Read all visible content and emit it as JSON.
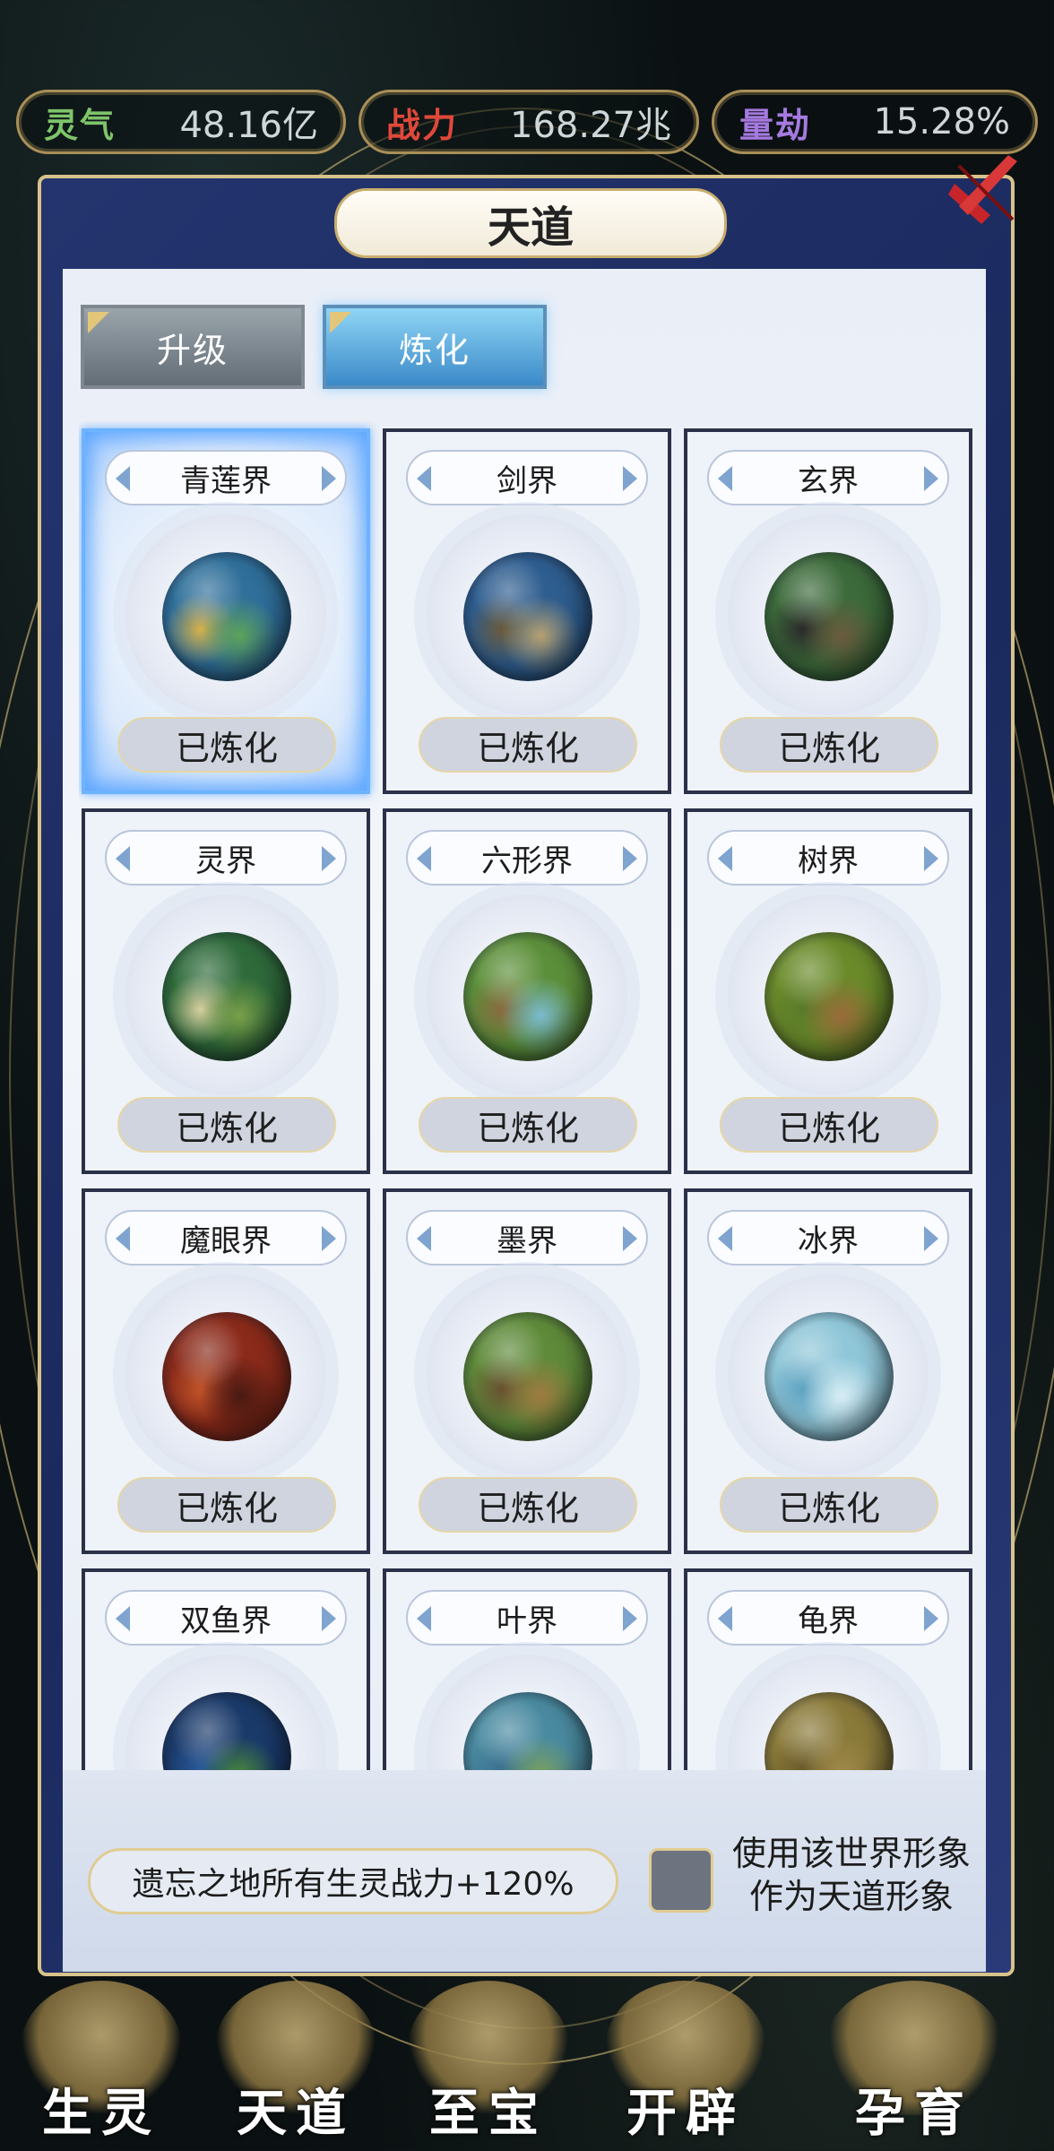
{
  "resources": [
    {
      "key": "灵气",
      "value": "48.16亿",
      "color": "#7ec46a"
    },
    {
      "key": "战力",
      "value": "168.27兆",
      "color": "#e0483a"
    },
    {
      "key": "量劫",
      "value": "15.28%",
      "color": "#a67ae0"
    }
  ],
  "panel": {
    "title": "天道"
  },
  "tabs": [
    {
      "label": "升级",
      "active": false
    },
    {
      "label": "炼化",
      "active": true
    }
  ],
  "worlds": [
    {
      "name": "青莲界",
      "status": "已炼化",
      "selected": true,
      "colors": [
        "#2f6f9a",
        "#5ea35a",
        "#d8b24a"
      ]
    },
    {
      "name": "剑界",
      "status": "已炼化",
      "selected": false,
      "colors": [
        "#2e5d8f",
        "#b7a170",
        "#6b5a3a"
      ]
    },
    {
      "name": "玄界",
      "status": "已炼化",
      "selected": false,
      "colors": [
        "#3c6a3a",
        "#6b5a3e",
        "#2a2a2a"
      ]
    },
    {
      "name": "灵界",
      "status": "已炼化",
      "selected": false,
      "colors": [
        "#2e6a3a",
        "#7aa04a",
        "#d9d0a0"
      ]
    },
    {
      "name": "六形界",
      "status": "已炼化",
      "selected": false,
      "colors": [
        "#5c8f3a",
        "#7cbad0",
        "#8a6a40"
      ]
    },
    {
      "name": "树界",
      "status": "已炼化",
      "selected": false,
      "colors": [
        "#6a8a2a",
        "#9a6a3a",
        "#5a7a2a"
      ]
    },
    {
      "name": "魔眼界",
      "status": "已炼化",
      "selected": false,
      "colors": [
        "#8a2a1a",
        "#4a1a12",
        "#c0542a"
      ]
    },
    {
      "name": "墨界",
      "status": "已炼化",
      "selected": false,
      "colors": [
        "#5f8a3a",
        "#a07a40",
        "#6a5030"
      ]
    },
    {
      "name": "冰界",
      "status": "已炼化",
      "selected": false,
      "colors": [
        "#8fc6d8",
        "#d8eef5",
        "#5fa2c0"
      ]
    },
    {
      "name": "双鱼界",
      "status": "",
      "selected": false,
      "colors": [
        "#1a3a6a",
        "#4a8a3a",
        "#2a5a9a"
      ]
    },
    {
      "name": "叶界",
      "status": "",
      "selected": false,
      "colors": [
        "#4a8aa0",
        "#7aa05a",
        "#3a7090"
      ]
    },
    {
      "name": "龟界",
      "status": "",
      "selected": false,
      "colors": [
        "#8a7a3a",
        "#a08a4a",
        "#6a5a2a"
      ]
    }
  ],
  "footer": {
    "bonus": "遗忘之地所有生灵战力+120%",
    "use_line1": "使用该世界形象",
    "use_line2": "作为天道形象",
    "checkbox_checked": false
  },
  "nav": [
    "生灵",
    "天道",
    "至宝",
    "开辟",
    "孕育"
  ]
}
